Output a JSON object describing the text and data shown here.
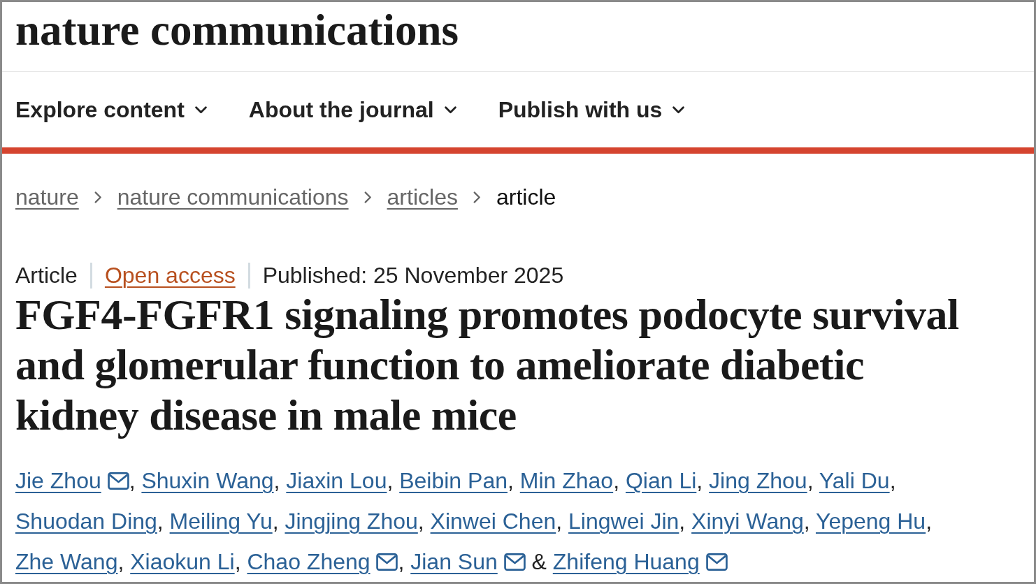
{
  "site": {
    "logo": "nature communications"
  },
  "nav": [
    {
      "label": "Explore content"
    },
    {
      "label": "About the journal"
    },
    {
      "label": "Publish with us"
    }
  ],
  "breadcrumbs": [
    {
      "label": "nature",
      "current": false
    },
    {
      "label": "nature communications",
      "current": false
    },
    {
      "label": "articles",
      "current": false
    },
    {
      "label": "article",
      "current": true
    }
  ],
  "article": {
    "type": "Article",
    "access": "Open access",
    "published": "Published: 25 November 2025",
    "title": "FGF4-FGFR1 signaling promotes podocyte survival and glomerular function to ameliorate diabetic kidney disease in male mice",
    "authors": [
      {
        "name": "Jie Zhou",
        "email": true
      },
      {
        "name": "Shuxin Wang",
        "email": false
      },
      {
        "name": "Jiaxin Lou",
        "email": false
      },
      {
        "name": "Beibin Pan",
        "email": false
      },
      {
        "name": "Min Zhao",
        "email": false
      },
      {
        "name": "Qian Li",
        "email": false
      },
      {
        "name": "Jing Zhou",
        "email": false
      },
      {
        "name": "Yali Du",
        "email": false
      },
      {
        "name": "Shuodan Ding",
        "email": false
      },
      {
        "name": "Meiling Yu",
        "email": false
      },
      {
        "name": "Jingjing Zhou",
        "email": false
      },
      {
        "name": "Xinwei Chen",
        "email": false
      },
      {
        "name": "Lingwei Jin",
        "email": false
      },
      {
        "name": "Xinyi Wang",
        "email": false
      },
      {
        "name": "Yepeng Hu",
        "email": false
      },
      {
        "name": "Zhe Wang",
        "email": false
      },
      {
        "name": "Xiaokun Li",
        "email": false
      },
      {
        "name": "Chao Zheng",
        "email": true
      },
      {
        "name": "Jian Sun",
        "email": true
      },
      {
        "name": "Zhifeng Huang",
        "email": true
      }
    ],
    "author_separator": ",",
    "last_author_separator": "&"
  }
}
